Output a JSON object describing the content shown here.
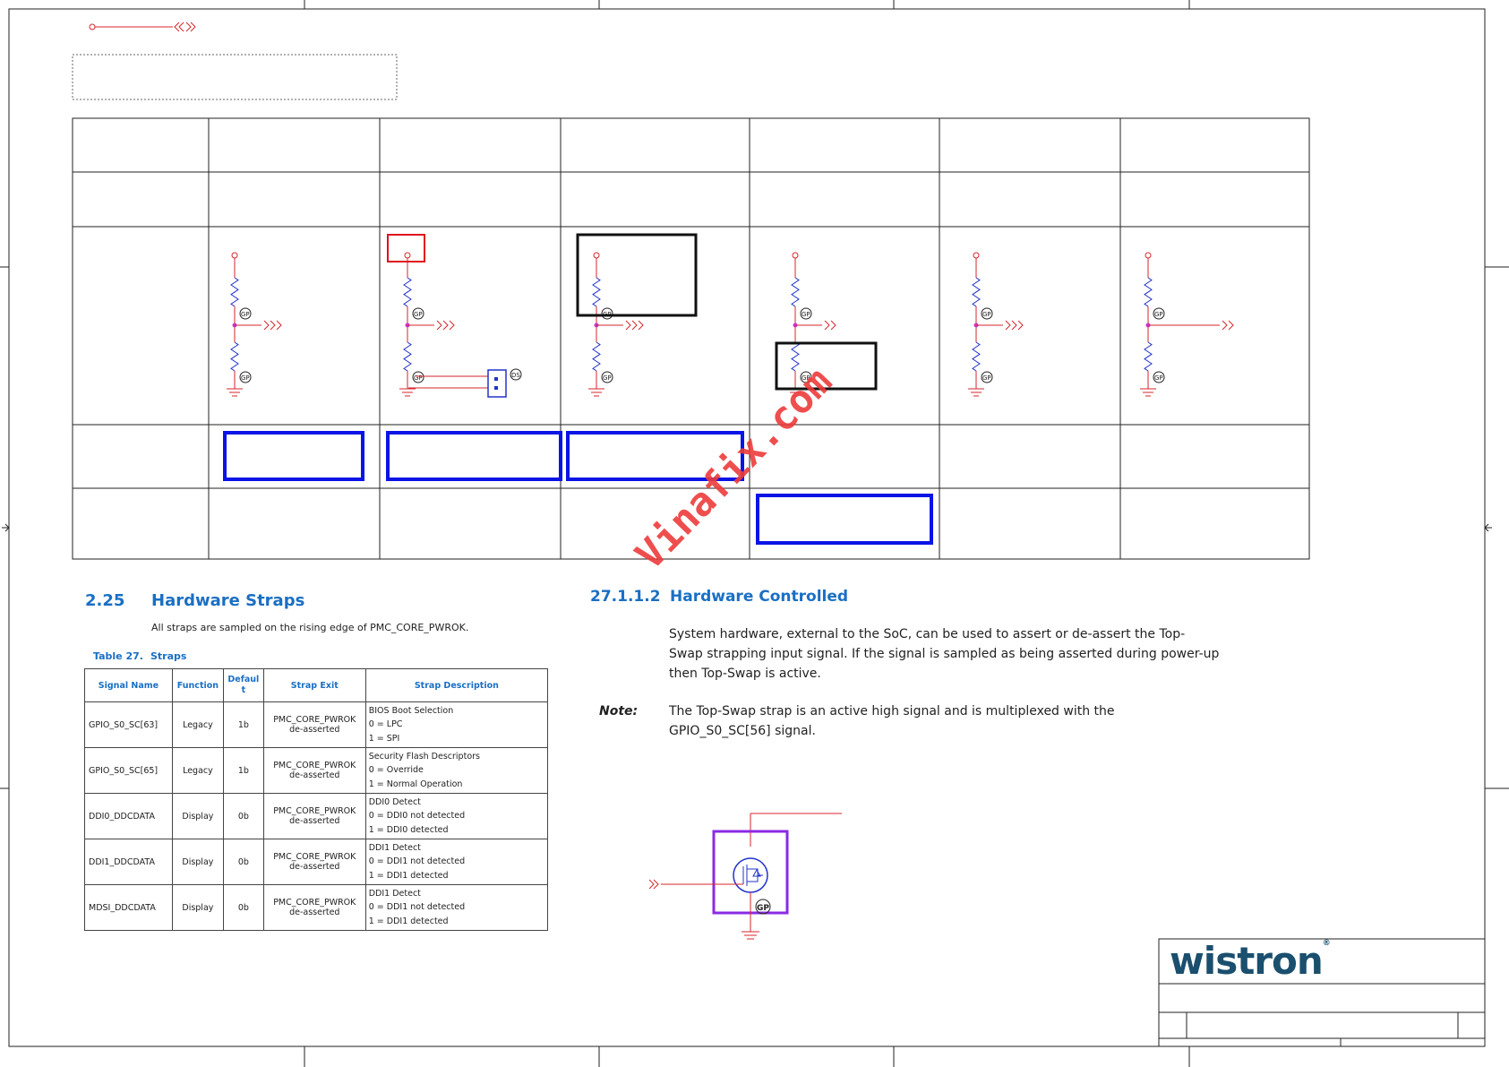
{
  "section_left": {
    "number": "2.25",
    "title": "Hardware Straps",
    "intro": "All straps are sampled on the rising edge of PMC_CORE_PWROK.",
    "table_caption_num": "Table 27.",
    "table_caption_title": "Straps"
  },
  "straps_table": {
    "headers": [
      "Signal Name",
      "Function",
      "Defaul t",
      "Strap Exit",
      "Strap Description"
    ],
    "rows": [
      {
        "signal": "GPIO_S0_SC[63]",
        "function": "Legacy",
        "default": "1b",
        "exit1": "PMC_CORE_PWROK",
        "exit2": "de-asserted",
        "desc": [
          "BIOS Boot Selection",
          "0 = LPC",
          "1 = SPI"
        ]
      },
      {
        "signal": "GPIO_S0_SC[65]",
        "function": "Legacy",
        "default": "1b",
        "exit1": "PMC_CORE_PWROK",
        "exit2": "de-asserted",
        "desc": [
          "Security Flash Descriptors",
          "0 = Override",
          "1 = Normal Operation"
        ]
      },
      {
        "signal": "DDI0_DDCDATA",
        "function": "Display",
        "default": "0b",
        "exit1": "PMC_CORE_PWROK",
        "exit2": "de-asserted",
        "desc": [
          "DDI0 Detect",
          "0 = DDI0 not detected",
          "1 = DDI0 detected"
        ]
      },
      {
        "signal": "DDI1_DDCDATA",
        "function": "Display",
        "default": "0b",
        "exit1": "PMC_CORE_PWROK",
        "exit2": "de-asserted",
        "desc": [
          "DDI1 Detect",
          "0 = DDI1 not detected",
          "1 = DDI1 detected"
        ]
      },
      {
        "signal": "MDSI_DDCDATA",
        "function": "Display",
        "default": "0b",
        "exit1": "PMC_CORE_PWROK",
        "exit2": "de-asserted",
        "desc": [
          "DDI1 Detect",
          "0 = DDI1 not detected",
          "1 = DDI1 detected"
        ]
      }
    ]
  },
  "section_right": {
    "number": "27.1.1.2",
    "title": "Hardware Controlled",
    "para": [
      "System hardware, external to the SoC, can be used to assert or de-assert the Top-",
      "Swap strapping input signal. If the signal is sampled as being asserted during power-up",
      "then Top-Swap is active."
    ],
    "note_label": "Note:",
    "note": [
      "The Top-Swap strap is an active high signal and is multiplexed with the",
      "GPIO_S0_SC[56] signal."
    ]
  },
  "watermark": "Vinafix.com",
  "logo": "wistron",
  "logo_mark": "®",
  "component_labels": {
    "gp": "GP",
    "ds": "DS"
  },
  "colors": {
    "wire": "#d7262b",
    "resistor": "#2233cc",
    "highlight_blue": "#0a14e6",
    "highlight_red": "#e0111a",
    "highlight_purple": "#8a2be2",
    "net_node": "#cc33cc",
    "frame": "#222222",
    "heading": "#1a6fc4"
  }
}
